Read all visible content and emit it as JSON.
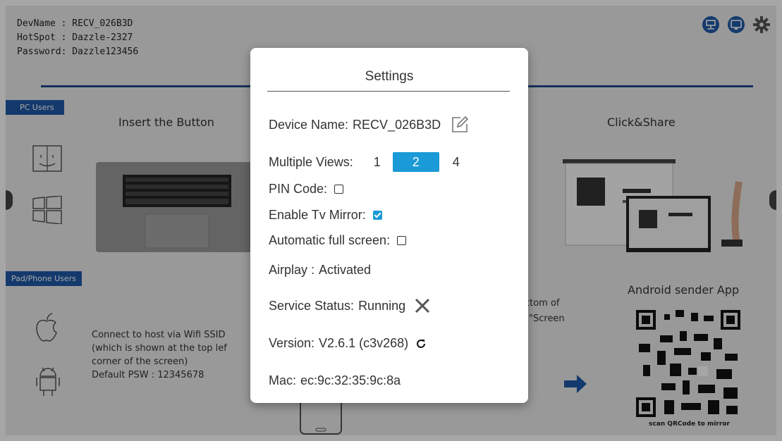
{
  "background": {
    "dev_info": {
      "devname": "DevName : RECV_026B3D",
      "hotspot": "HotSpot : Dazzle-2327",
      "password": "Password: Dazzle123456"
    },
    "pc_users_tag": "PC Users",
    "pad_phone_tag": "Pad/Phone Users",
    "insert_title": "Insert the Button",
    "click_share_title": "Click&Share",
    "android_title": "Android sender App",
    "connect_text": [
      "Connect to host via Wifi SSID",
      "(which is shown at the top lef",
      "corner of the screen)",
      "Default PSW : 12345678"
    ],
    "partial_text_1": "ttom of",
    "partial_text_2": "\"Screen",
    "qr_caption": "scan QRCode to mirror",
    "accent_color": "#1f5aa8"
  },
  "dialog": {
    "title": "Settings",
    "device_name_label": "Device Name:",
    "device_name_value": "RECV_026B3D",
    "multiple_views_label": "Multiple Views:",
    "views": [
      "1",
      "2",
      "4"
    ],
    "selected_view": "2",
    "pin_code_label": "PIN Code:",
    "pin_code_checked": false,
    "enable_tv_mirror_label": "Enable Tv Mirror:",
    "enable_tv_mirror_checked": true,
    "auto_full_screen_label": "Automatic full screen:",
    "auto_full_screen_checked": false,
    "airplay_label": "Airplay :",
    "airplay_value": "Activated",
    "service_status_label": "Service Status:",
    "service_status_value": "Running",
    "version_label": "Version:",
    "version_value": "V2.6.1 (c3v268)",
    "mac_label": "Mac:",
    "mac_value": "ec:9c:32:35:9c:8a",
    "accent_color": "#1a9ad6"
  }
}
